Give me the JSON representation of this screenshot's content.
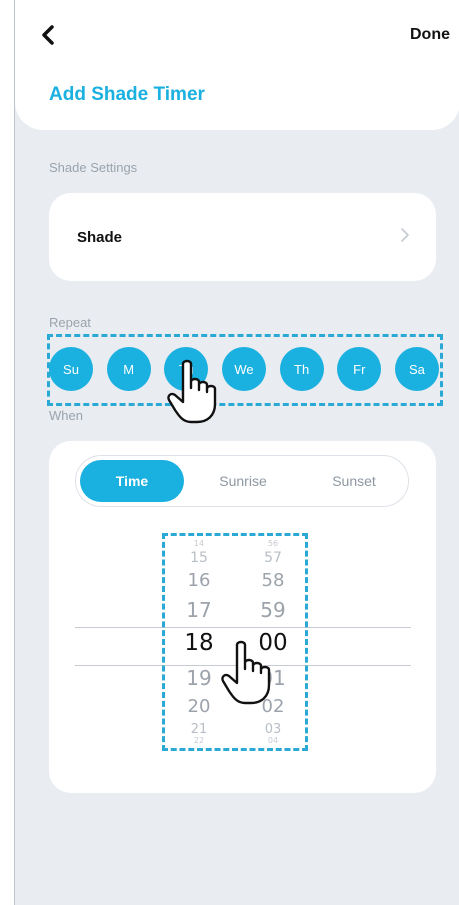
{
  "header": {
    "back_icon": "chevron-left-icon",
    "done_label": "Done",
    "title": "Add Shade Timer"
  },
  "shade_settings": {
    "section_label": "Shade Settings",
    "item_label": "Shade",
    "item_icon": "chevron-right-icon"
  },
  "repeat": {
    "section_label": "Repeat",
    "days": [
      "Su",
      "M",
      "Tu",
      "We",
      "Th",
      "Fr",
      "Sa"
    ]
  },
  "when": {
    "section_label": "When",
    "tabs": [
      {
        "label": "Time",
        "active": true
      },
      {
        "label": "Sunrise",
        "active": false
      },
      {
        "label": "Sunset",
        "active": false
      }
    ],
    "hours": [
      "14",
      "15",
      "16",
      "17",
      "18",
      "19",
      "20",
      "21",
      "22"
    ],
    "minutes": [
      "56",
      "57",
      "58",
      "59",
      "00",
      "01",
      "02",
      "03",
      "04"
    ],
    "selected_hour": "18",
    "selected_minute": "00"
  },
  "colors": {
    "accent": "#1ab0e0",
    "background": "#e9edf2",
    "highlight_box": "#2aa9d4"
  }
}
